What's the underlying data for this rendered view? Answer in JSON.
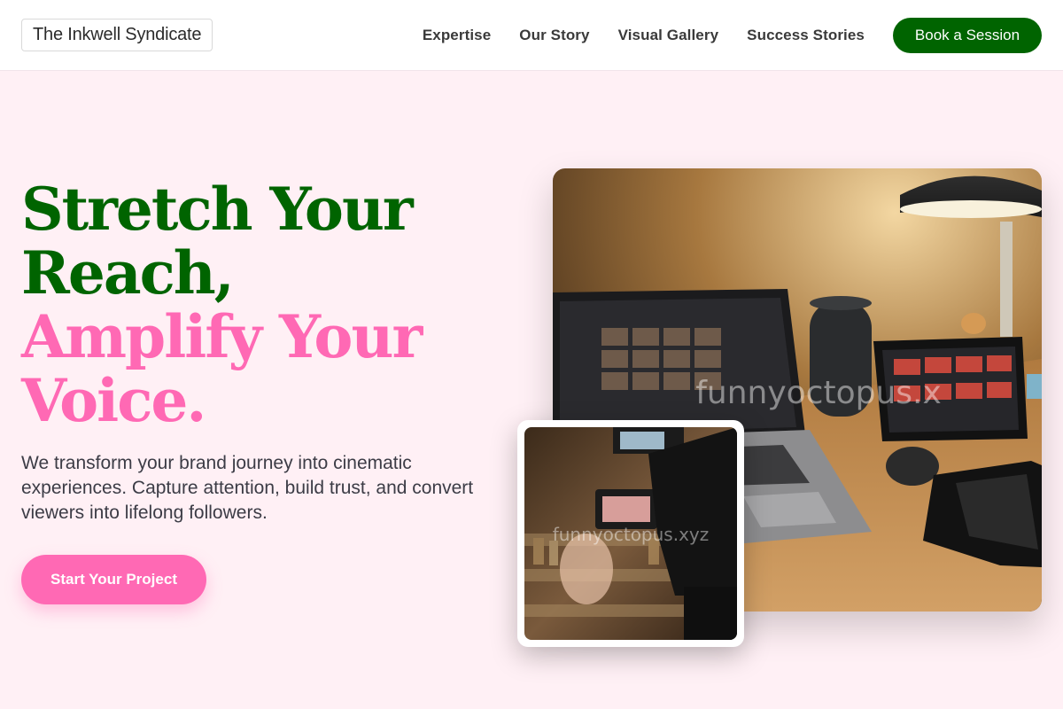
{
  "brand": {
    "name": "The Inkwell Syndicate"
  },
  "nav": {
    "links": [
      "Expertise",
      "Our Story",
      "Visual Gallery",
      "Success Stories"
    ],
    "cta_label": "Book a Session"
  },
  "hero": {
    "headline_green": "Stretch Your Reach,",
    "headline_pink": "Amplify Your Voice.",
    "subtext": "We transform your brand journey into cinematic experiences. Capture attention, build trust, and convert viewers into lifelong followers.",
    "button_label": "Start Your Project"
  },
  "images": {
    "main": {
      "watermark": "funnyoctopus.x"
    },
    "inset": {
      "watermark": "funnyoctopus.xyz"
    }
  },
  "colors": {
    "green": "#006400",
    "pink": "#ff69b4",
    "background": "#fff0f5"
  }
}
